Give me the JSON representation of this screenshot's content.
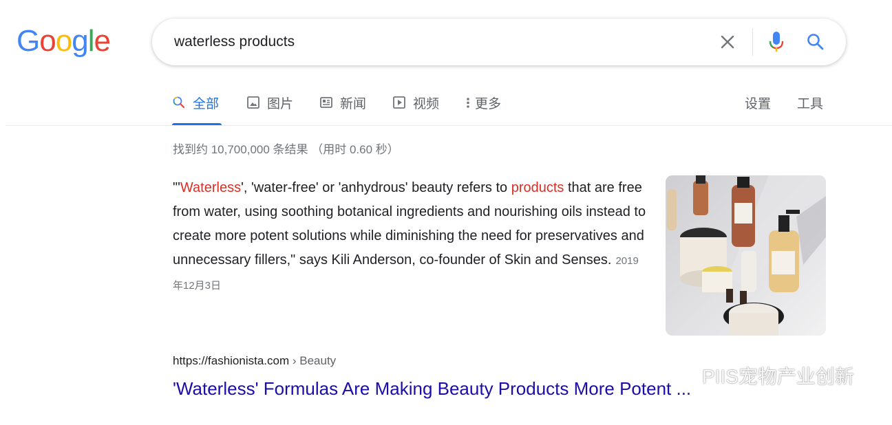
{
  "logo": {
    "text": "Google",
    "letters": [
      "G",
      "o",
      "o",
      "g",
      "l",
      "e"
    ],
    "colors": [
      "#4285f4",
      "#ea4335",
      "#fbbc05",
      "#4285f4",
      "#34a853",
      "#ea4335"
    ]
  },
  "search": {
    "query": "waterless products"
  },
  "tabs": [
    {
      "label": "全部",
      "icon": "search-icon",
      "active": true
    },
    {
      "label": "图片",
      "icon": "image-icon"
    },
    {
      "label": "新闻",
      "icon": "news-icon"
    },
    {
      "label": "视频",
      "icon": "video-icon"
    },
    {
      "label": "更多",
      "icon": "more-vert-icon"
    }
  ],
  "tools": {
    "settings": "设置",
    "tools": "工具"
  },
  "stats": "找到约 10,700,000 条结果  （用时 0.60 秒）",
  "snippet": {
    "prefix": "\"'",
    "hl1": "Waterless",
    "part2": "', 'water-free' or 'anhydrous' beauty refers to ",
    "hl2": "products",
    "part3": " that are free from water, using soothing botanical ingredients and nourishing oils instead to create more potent solutions while diminishing the need for preservatives and unnecessary fillers,\" says Kili Anderson, co-founder of Skin and Senses.",
    "date": "2019年12月3日"
  },
  "result": {
    "url": "https://fashionista.com",
    "breadcrumb": " › Beauty",
    "title": "'Waterless' Formulas Are Making Beauty Products More Potent ..."
  },
  "watermark": "PIIS宠物产业创新",
  "colors": {
    "accent": "#1a73e8",
    "link": "#1a0dab",
    "highlight": "#d93025"
  }
}
